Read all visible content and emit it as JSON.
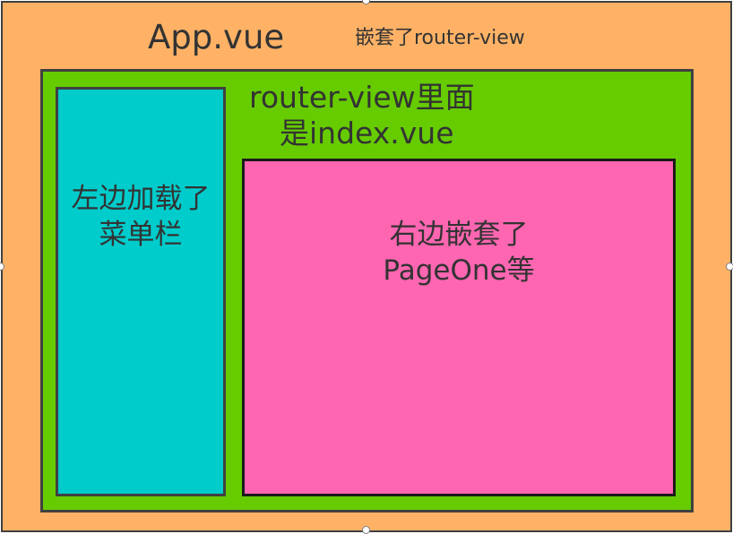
{
  "colors": {
    "app_fill": "#FFB266",
    "router_fill": "#66CC00",
    "menu_fill": "#00CCCC",
    "page_fill": "#FF66B2",
    "border": "#404040",
    "text": "#333333"
  },
  "app": {
    "title": "App.vue",
    "nest_note": "嵌套了router-view"
  },
  "router_view": {
    "line1": "router-view里面",
    "line2": "是index.vue"
  },
  "menu_panel": {
    "line1": "左边加载了",
    "line2": "菜单栏"
  },
  "page_panel": {
    "line1": "右边嵌套了",
    "line2": "PageOne等"
  }
}
